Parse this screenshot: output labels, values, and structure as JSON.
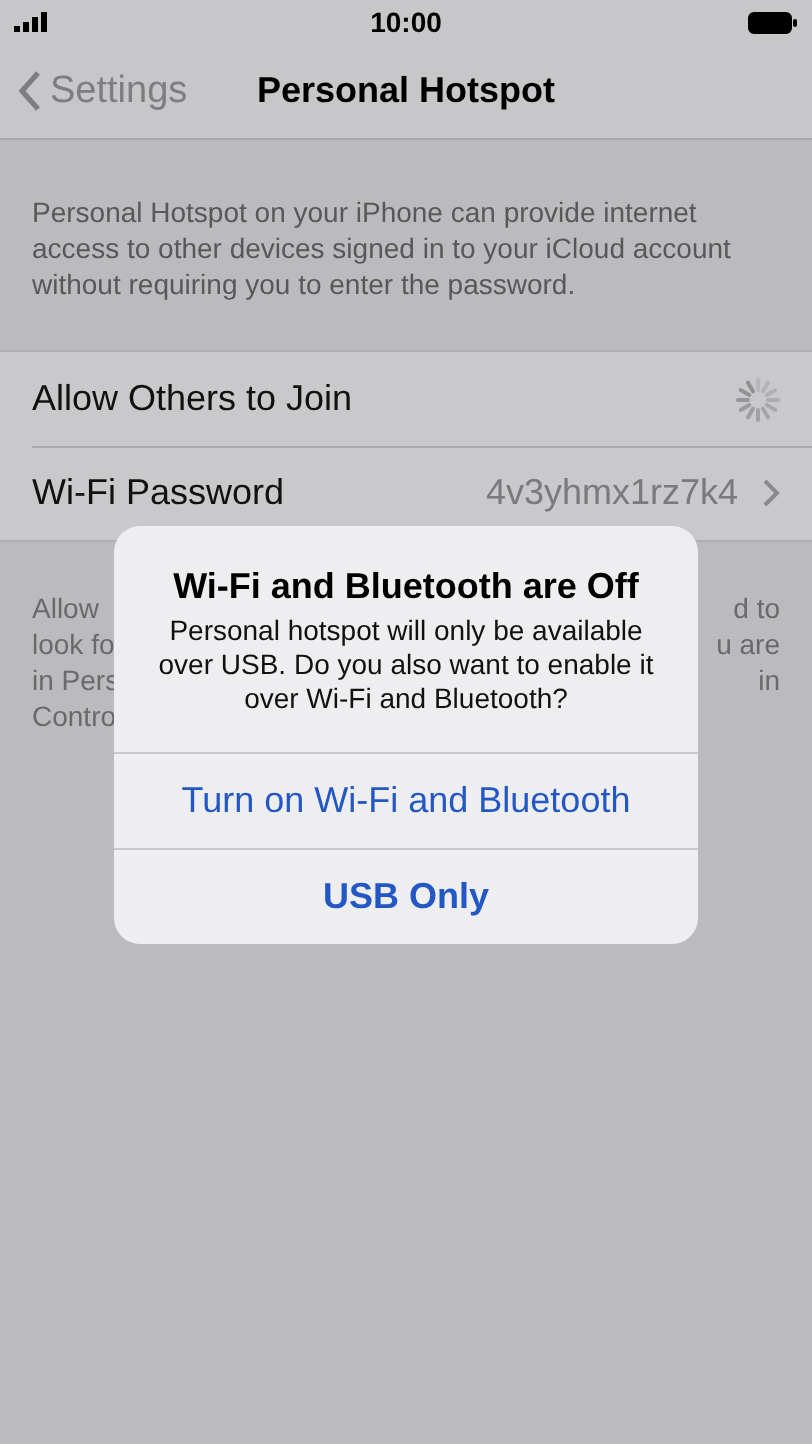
{
  "status_bar": {
    "time": "10:00"
  },
  "nav": {
    "back_label": "Settings",
    "title": "Personal Hotspot"
  },
  "description": "Personal Hotspot on your iPhone can provide internet access to other devices signed in to your iCloud account without requiring you to enter the password.",
  "rows": [
    {
      "kind": "spinner",
      "label": "Allow Others to Join"
    },
    {
      "kind": "value",
      "label": "Wi-Fi Password",
      "value": "4v3yhmx1rz7k4"
    }
  ],
  "footer_fragments": [
    {
      "left": "Allow",
      "right": "d to"
    },
    {
      "left": "look fo",
      "right": "u are"
    },
    {
      "left": "in Pers",
      "right": "in"
    },
    {
      "left": "Contro"
    }
  ],
  "alert": {
    "title": "Wi-Fi and Bluetooth are Off",
    "message": "Personal hotspot will only be available over USB. Do you also want to enable it over Wi-Fi and Bluetooth?",
    "buttons": [
      {
        "label": "Turn on Wi-Fi and Bluetooth",
        "bold": false
      },
      {
        "label": "USB Only",
        "bold": true
      }
    ]
  }
}
